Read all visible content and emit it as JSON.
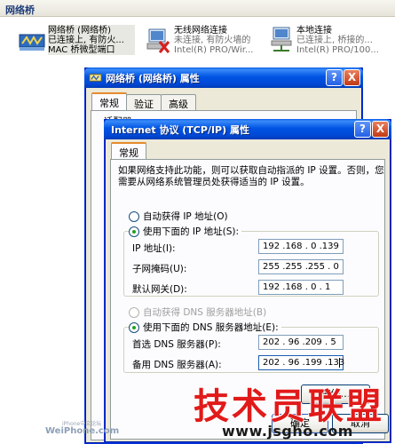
{
  "folder": {
    "title": "网络桥"
  },
  "connections": [
    {
      "name": "网络桥 (网络桥)",
      "status": "已连接上, 有防火...",
      "device": "MAC 桥微型端口",
      "icon": "network-bridge-icon"
    },
    {
      "name": "无线网络连接",
      "status": "未连接, 有防火墙的",
      "device": "Intel(R) PRO/Wir...",
      "icon": "wireless-disconnected-icon"
    },
    {
      "name": "本地连接",
      "status": "已连接上, 桥接的...",
      "device": "Intel(R) PRO/100...",
      "icon": "lan-connection-icon"
    }
  ],
  "bridge_dialog": {
    "title": "网络桥 (网络桥) 属性",
    "tabs": [
      "常规",
      "验证",
      "高级"
    ],
    "partial_text": "适配器:"
  },
  "tcpip_dialog": {
    "title": "Internet 协议 (TCP/IP) 属性",
    "tab": "常规",
    "description": "如果网络支持此功能，则可以获取自动指派的 IP 设置。否则，您需要从网络系统管理员处获得适当的 IP 设置。",
    "auto_ip": "自动获得 IP 地址(O)",
    "manual_ip": "使用下面的 IP 地址(S):",
    "ip_label": "IP 地址(I):",
    "ip_value": "192 .168 . 0 .139",
    "mask_label": "子网掩码(U):",
    "mask_value": "255 .255 .255 . 0",
    "gateway_label": "默认网关(D):",
    "gateway_value": "192 .168 . 0 . 1",
    "auto_dns": "自动获得 DNS 服务器地址(B)",
    "manual_dns": "使用下面的 DNS 服务器地址(E):",
    "dns1_label": "首选 DNS 服务器(P):",
    "dns1_value": "202 . 96 .209 . 5",
    "dns2_label": "备用 DNS 服务器(A):",
    "dns2_value": "202 . 96 .199 .133",
    "help_btn": "?",
    "close_btn": "X",
    "advanced_btn": "高级...",
    "ok_btn": "确定",
    "cancel_btn": "取消"
  },
  "watermarks": {
    "site_cn": "技术员联盟",
    "site_url": "www.jsgho.com",
    "weiphone_small": "iPhone中文论坛",
    "weiphone": "WeiPhone.com"
  },
  "colors": {
    "titlebar": "#0054e3",
    "dialog_bg": "#ece9d8",
    "watermark_red": "#e11a1a"
  }
}
